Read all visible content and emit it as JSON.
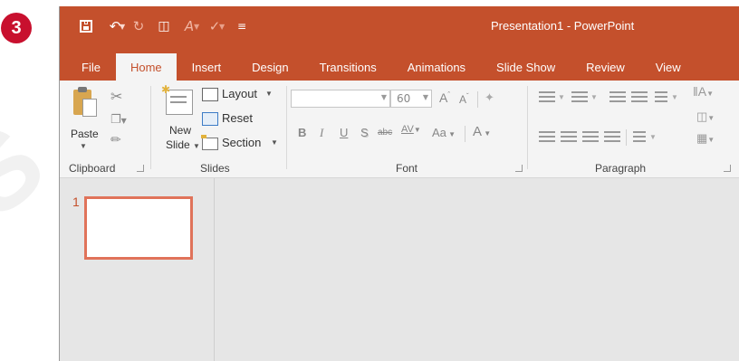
{
  "step_badge": "3",
  "window": {
    "title": "Presentation1 - PowerPoint",
    "accent_color": "#c4502c"
  },
  "quick_access": {
    "items": [
      "save-icon",
      "undo-icon",
      "redo-icon",
      "start-from-beginning-icon",
      "format-painter-icon",
      "customize-icon"
    ]
  },
  "tabs": [
    {
      "label": "File",
      "active": false
    },
    {
      "label": "Home",
      "active": true
    },
    {
      "label": "Insert",
      "active": false
    },
    {
      "label": "Design",
      "active": false
    },
    {
      "label": "Transitions",
      "active": false
    },
    {
      "label": "Animations",
      "active": false
    },
    {
      "label": "Slide Show",
      "active": false
    },
    {
      "label": "Review",
      "active": false
    },
    {
      "label": "View",
      "active": false
    }
  ],
  "ribbon": {
    "clipboard": {
      "label": "Clipboard",
      "paste_label": "Paste"
    },
    "slides": {
      "label": "Slides",
      "new_slide_line1": "New",
      "new_slide_line2": "Slide",
      "layout_label": "Layout",
      "reset_label": "Reset",
      "section_label": "Section"
    },
    "font": {
      "label": "Font",
      "font_name_value": "",
      "font_size_value": "60",
      "bold": "B",
      "italic": "I",
      "underline": "U",
      "shadow": "S",
      "strikethrough": "abc",
      "spacing": "AV",
      "change_case": "Aa",
      "font_color": "A",
      "grow": "A",
      "shrink": "A"
    },
    "paragraph": {
      "label": "Paragraph"
    }
  },
  "slides_pane": {
    "slide_number": "1"
  }
}
